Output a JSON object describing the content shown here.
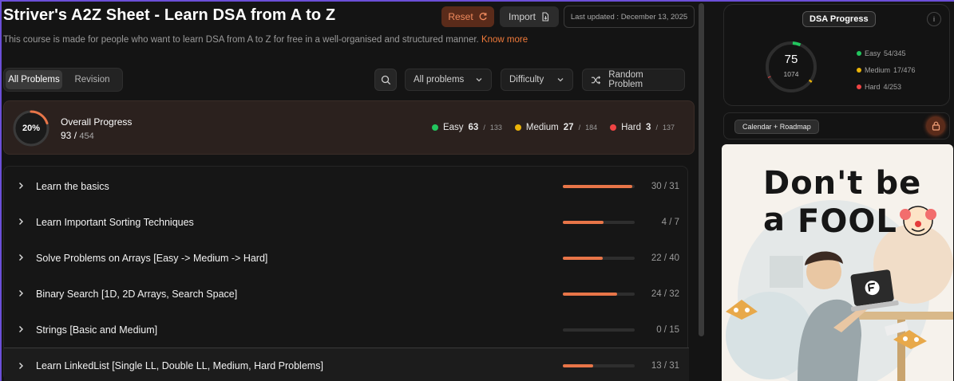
{
  "header": {
    "title": "Striver's A2Z Sheet - Learn DSA from A to Z",
    "reset_label": "Reset",
    "import_label": "Import",
    "last_updated": "Last updated : December 13, 2025",
    "description": "This course is made for people who want to learn DSA from A to Z for free in a well-organised and structured manner.",
    "know_more": "Know more"
  },
  "toolbar": {
    "tabs": [
      {
        "label": "All Problems",
        "active": true
      },
      {
        "label": "Revision",
        "active": false
      }
    ],
    "filter_problems": "All problems",
    "filter_difficulty": "Difficulty",
    "random_label": "Random Problem"
  },
  "overall": {
    "percent_label": "20%",
    "percent": 0.2,
    "title": "Overall Progress",
    "solved": "93",
    "total": "454",
    "easy": {
      "label": "Easy",
      "solved": "63",
      "total": "133",
      "color": "#22c55e"
    },
    "medium": {
      "label": "Medium",
      "solved": "27",
      "total": "184",
      "color": "#eab308"
    },
    "hard": {
      "label": "Hard",
      "solved": "3",
      "total": "137",
      "color": "#ef4444"
    }
  },
  "topics": [
    {
      "label": "Learn the basics",
      "solved": 30,
      "total": 31,
      "count": "30 / 31"
    },
    {
      "label": "Learn Important Sorting Techniques",
      "solved": 4,
      "total": 7,
      "count": "4 / 7"
    },
    {
      "label": "Solve Problems on Arrays [Easy -> Medium -> Hard]",
      "solved": 22,
      "total": 40,
      "count": "22 / 40"
    },
    {
      "label": "Binary Search [1D, 2D Arrays, Search Space]",
      "solved": 24,
      "total": 32,
      "count": "24 / 32"
    },
    {
      "label": "Strings [Basic and Medium]",
      "solved": 0,
      "total": 15,
      "count": "0 / 15"
    },
    {
      "label": "Learn LinkedList [Single LL, Double LL, Medium, Hard Problems]",
      "solved": 13,
      "total": 31,
      "count": "13 / 31"
    }
  ],
  "sidebar": {
    "progress_title": "DSA Progress",
    "info_icon": "i",
    "solved": "75",
    "total": "1074",
    "easy": {
      "label": "Easy",
      "value": "54/345",
      "solved": 54,
      "total": 345
    },
    "medium": {
      "label": "Medium",
      "value": "17/476",
      "solved": 17,
      "total": 476
    },
    "hard": {
      "label": "Hard",
      "value": "4/253",
      "solved": 4,
      "total": 253
    },
    "calendar_label": "Calendar + Roadmap",
    "poster_line1": "Don't be a",
    "poster_line2": "FOOL"
  },
  "colors": {
    "accent": "#e87548",
    "easy": "#22c55e",
    "medium": "#eab308",
    "hard": "#ef4444"
  }
}
